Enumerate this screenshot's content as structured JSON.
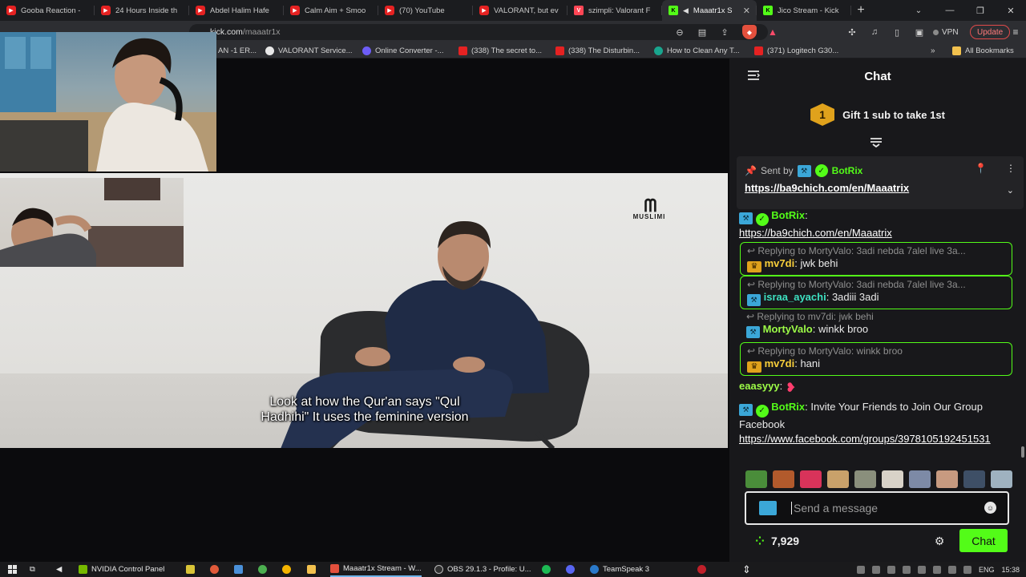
{
  "browser": {
    "tabs": [
      {
        "label": "Gooba Reaction - ",
        "icon": "youtube-icon"
      },
      {
        "label": "24 Hours Inside th",
        "icon": "youtube-icon"
      },
      {
        "label": "Abdel Halim Hafe",
        "icon": "youtube-icon"
      },
      {
        "label": "Calm Aim + Smoo",
        "icon": "youtube-icon"
      },
      {
        "label": "(70) YouTube",
        "icon": "youtube-icon"
      },
      {
        "label": "VALORANT, but ev",
        "icon": "youtube-icon"
      },
      {
        "label": "szimpli: Valorant F",
        "icon": "valorant-icon"
      },
      {
        "label": "Maaatr1x S",
        "icon": "kick-icon",
        "active": true
      },
      {
        "label": "Jico Stream - Kick",
        "icon": "kick-icon"
      }
    ],
    "url_host": "kick.com",
    "url_path": "/maaatr1x",
    "vpn_label": "VPN",
    "update_label": "Update",
    "bookmarks": [
      {
        "label": "AN -1 ER...",
        "icon": "youtube-icon"
      },
      {
        "label": "VALORANT Service...",
        "icon": "valorant-icon"
      },
      {
        "label": "Online Converter -...",
        "icon": "converter-icon"
      },
      {
        "label": "(338) The secret to...",
        "icon": "youtube-icon"
      },
      {
        "label": "(338) The Disturbin...",
        "icon": "youtube-icon"
      },
      {
        "label": "How to Clean Any T...",
        "icon": "clean-icon"
      },
      {
        "label": "(371) Logitech G30...",
        "icon": "youtube-icon"
      }
    ],
    "all_bookmarks_label": "All Bookmarks"
  },
  "video": {
    "subtitle_line1": "Look at how the Qur'an says \"Qul",
    "subtitle_line2": "Hadhihi\" It uses the feminine version",
    "channel_logo_text": "MUSLIMI"
  },
  "chat": {
    "title": "Chat",
    "gift_count": "1",
    "gift_text": "Gift 1 sub to take 1st",
    "pinned": {
      "sent_by_label": "Sent by",
      "user": "BotRix",
      "link": "https://ba9chich.com/en/Maaatrix"
    },
    "messages": [
      {
        "type": "bot",
        "user": "BotRix",
        "text": "https://ba9chich.com/en/Maaatrix"
      },
      {
        "type": "reply",
        "reply_to": "Replying to MortyValo: 3adi nebda 7alel live 3a...",
        "user": "mv7di",
        "text": "jwk behi",
        "highlight": true
      },
      {
        "type": "reply",
        "reply_to": "Replying to MortyValo: 3adi nebda 7alel live 3a...",
        "user": "israa_ayachi",
        "text": "3adiii 3adi",
        "highlight": true
      },
      {
        "type": "reply",
        "reply_to": "Replying to mv7di: jwk behi",
        "user": "MortyValo",
        "text": "winkk broo",
        "highlight": false
      },
      {
        "type": "reply",
        "reply_to": "Replying to MortyValo: winkk broo",
        "user": "mv7di",
        "text": "hani",
        "highlight": true
      },
      {
        "type": "emote",
        "user": "eaasyyy"
      },
      {
        "type": "bot",
        "user": "BotRix",
        "text": "Invite Your Friends to Join Our Group Facebook",
        "link": "https://www.facebook.com/groups/3978105192451531"
      }
    ],
    "input_placeholder": "Send a message",
    "points": "7,929",
    "send_label": "Chat",
    "accent_color": "#53fc18"
  },
  "taskbar": {
    "items": [
      {
        "label": "NVIDIA Control Panel",
        "icon": "nvidia-icon"
      },
      {
        "label": "Maaatr1x Stream - W...",
        "icon": "brave-icon",
        "active": true
      },
      {
        "label": "OBS 29.1.3 - Profile: U...",
        "icon": "obs-icon"
      },
      {
        "label": "TeamSpeak 3",
        "icon": "teamspeak-icon"
      }
    ],
    "lang": "ENG",
    "time": "15:38"
  }
}
